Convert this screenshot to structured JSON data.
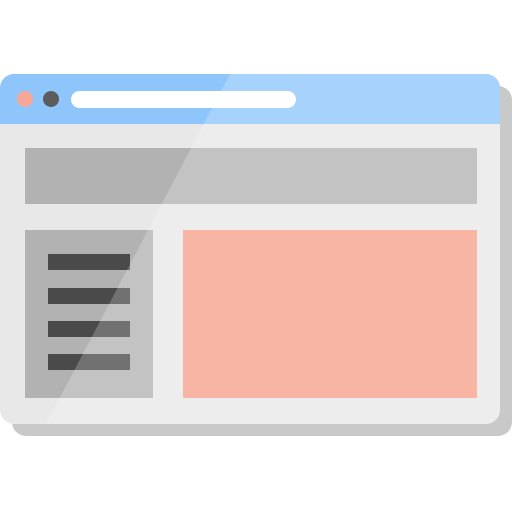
{
  "illustration": {
    "kind": "browser-window-icon",
    "colors": {
      "background": "#ffffff",
      "shadow": "#c9c9c9",
      "window_body": "#e8e8e8",
      "title_bar": "#8ec6fb",
      "address_bar": "#ffffff",
      "close_dot": "#f5a898",
      "minimize_dot": "#5c5c5c",
      "header_banner": "#b2b2b2",
      "sidebar_panel": "#b2b2b2",
      "menu_line": "#4a4a4a",
      "content_area": "#f8a18a",
      "gloss": "#ffffff"
    },
    "title_bar": {
      "dots": [
        {
          "name": "close-dot",
          "color_key": "close_dot"
        },
        {
          "name": "minimize-dot",
          "color_key": "minimize_dot"
        }
      ]
    },
    "sidebar": {
      "menu_lines": 4
    }
  }
}
